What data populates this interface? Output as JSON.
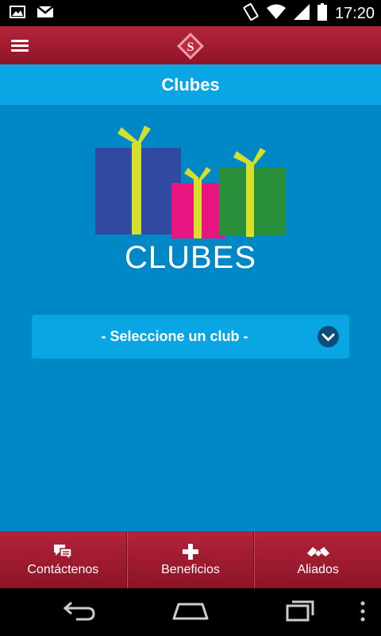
{
  "status_bar": {
    "time": "17:20",
    "icons": [
      "image-icon",
      "gmail-icon",
      "vibrate-icon",
      "wifi-icon",
      "signal-icon",
      "battery-icon"
    ]
  },
  "app_bar": {
    "logo_letter": "S",
    "menu_icon": "hamburger-menu-icon"
  },
  "header": {
    "title": "Clubes"
  },
  "main": {
    "banner_text": "CLUBES",
    "club_select": {
      "value": "- Seleccione un club -",
      "icon": "chevron-down-icon"
    }
  },
  "bottom_nav": {
    "items": [
      {
        "label": "Contáctenos",
        "icon": "chat-icon"
      },
      {
        "label": "Beneficios",
        "icon": "plus-icon"
      },
      {
        "label": "Aliados",
        "icon": "handshake-icon"
      }
    ]
  },
  "system_nav": {
    "buttons": [
      "back-icon",
      "home-icon",
      "recents-icon",
      "more-icon"
    ]
  },
  "colors": {
    "primary_red": "#a01c32",
    "blue_background": "#0088c6",
    "light_blue": "#0aa6e3"
  }
}
